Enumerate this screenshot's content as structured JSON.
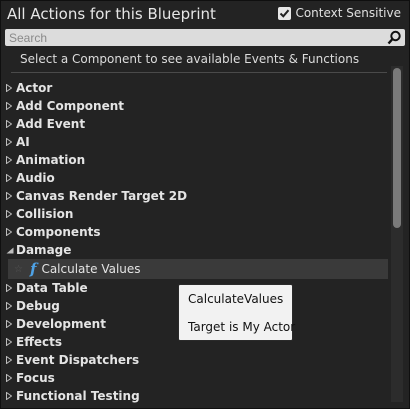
{
  "header": {
    "title": "All Actions for this Blueprint",
    "context_sensitive_label": "Context Sensitive",
    "context_sensitive_checked": true
  },
  "search": {
    "value": "",
    "placeholder": "Search",
    "icon": "search-icon"
  },
  "hint": "Select a Component to see available Events & Functions",
  "categories": [
    {
      "label": "Actor",
      "expanded": false
    },
    {
      "label": "Add Component",
      "expanded": false
    },
    {
      "label": "Add Event",
      "expanded": false
    },
    {
      "label": "AI",
      "expanded": false
    },
    {
      "label": "Animation",
      "expanded": false
    },
    {
      "label": "Audio",
      "expanded": false
    },
    {
      "label": "Canvas Render Target 2D",
      "expanded": false
    },
    {
      "label": "Collision",
      "expanded": false
    },
    {
      "label": "Components",
      "expanded": false
    },
    {
      "label": "Damage",
      "expanded": true
    },
    {
      "label": "Data Table",
      "expanded": false
    },
    {
      "label": "Debug",
      "expanded": false
    },
    {
      "label": "Development",
      "expanded": false
    },
    {
      "label": "Effects",
      "expanded": false
    },
    {
      "label": "Event Dispatchers",
      "expanded": false
    },
    {
      "label": "Focus",
      "expanded": false
    },
    {
      "label": "Functional Testing",
      "expanded": false
    }
  ],
  "damage_items": [
    {
      "label": "Calculate Values",
      "icon": "function-icon",
      "highlighted": true
    }
  ],
  "tooltip": {
    "name": "CalculateValues",
    "target": "Target is My Actor"
  },
  "colors": {
    "background": "#232323",
    "function_icon": "#4ea2e6",
    "tooltip_bg": "#f2f2f2"
  }
}
